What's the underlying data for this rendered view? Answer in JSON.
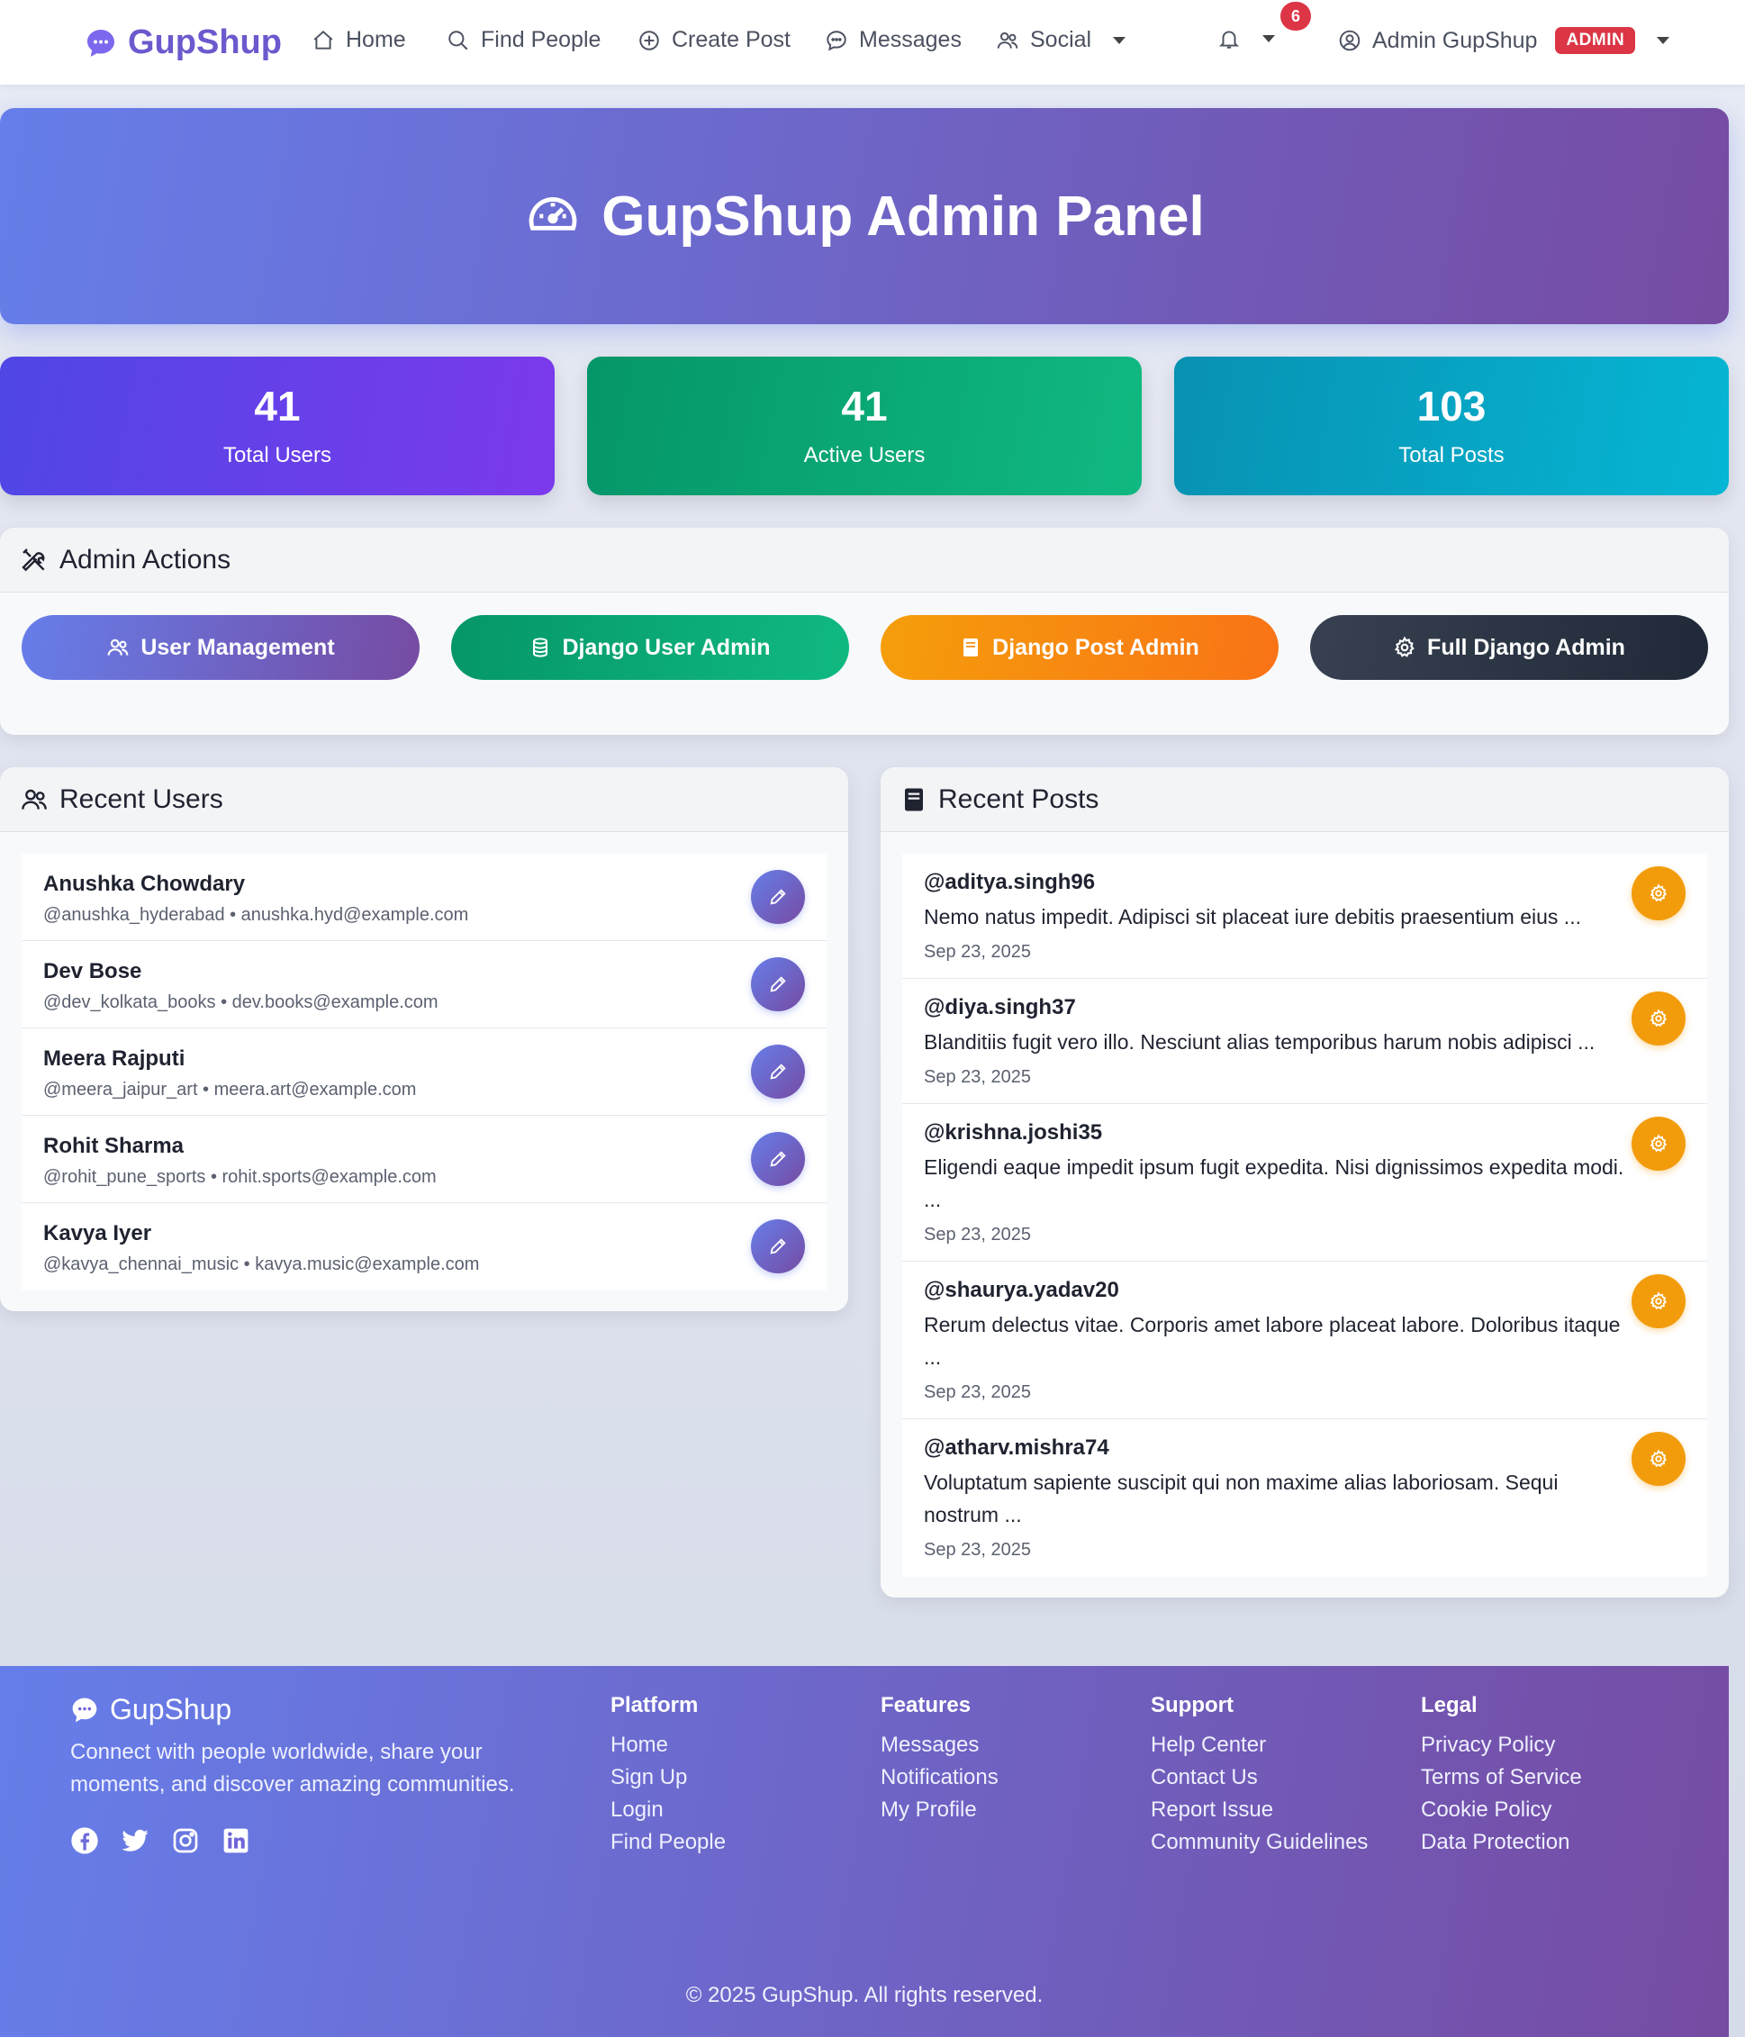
{
  "nav": {
    "brand": "GupShup",
    "items": [
      {
        "label": "Home",
        "icon": "home-icon"
      },
      {
        "label": "Find People",
        "icon": "search-icon"
      },
      {
        "label": "Create Post",
        "icon": "plus-circle-icon"
      },
      {
        "label": "Messages",
        "icon": "chat-icon"
      },
      {
        "label": "Social",
        "icon": "people-icon"
      }
    ],
    "notification_count": "6",
    "user_name": "Admin GupShup",
    "role_badge": "ADMIN"
  },
  "hero": {
    "title": "GupShup Admin Panel",
    "icon": "speedometer-icon"
  },
  "stats": [
    {
      "value": "41",
      "label": "Total Users"
    },
    {
      "value": "41",
      "label": "Active Users"
    },
    {
      "value": "103",
      "label": "Total Posts"
    }
  ],
  "actions": {
    "title": "Admin Actions",
    "buttons": [
      {
        "label": "User Management",
        "icon": "people-icon"
      },
      {
        "label": "Django User Admin",
        "icon": "database-icon"
      },
      {
        "label": "Django Post Admin",
        "icon": "file-icon"
      },
      {
        "label": "Full Django Admin",
        "icon": "gear-icon"
      }
    ]
  },
  "recent_users": {
    "title": "Recent Users",
    "items": [
      {
        "name": "Anushka Chowdary",
        "meta": "@anushka_hyderabad • anushka.hyd@example.com"
      },
      {
        "name": "Dev Bose",
        "meta": "@dev_kolkata_books • dev.books@example.com"
      },
      {
        "name": "Meera Rajputi",
        "meta": "@meera_jaipur_art • meera.art@example.com"
      },
      {
        "name": "Rohit Sharma",
        "meta": "@rohit_pune_sports • rohit.sports@example.com"
      },
      {
        "name": "Kavya Iyer",
        "meta": "@kavya_chennai_music • kavya.music@example.com"
      }
    ]
  },
  "recent_posts": {
    "title": "Recent Posts",
    "items": [
      {
        "user": "@aditya.singh96",
        "text": "Nemo natus impedit. Adipisci sit placeat iure debitis praesentium eius ...",
        "date": "Sep 23, 2025"
      },
      {
        "user": "@diya.singh37",
        "text": "Blanditiis fugit vero illo. Nesciunt alias temporibus harum nobis adipisci ...",
        "date": "Sep 23, 2025"
      },
      {
        "user": "@krishna.joshi35",
        "text": "Eligendi eaque impedit ipsum fugit expedita. Nisi dignissimos expedita modi. ...",
        "date": "Sep 23, 2025"
      },
      {
        "user": "@shaurya.yadav20",
        "text": "Rerum delectus vitae. Corporis amet labore placeat labore. Doloribus itaque ...",
        "date": "Sep 23, 2025"
      },
      {
        "user": "@atharv.mishra74",
        "text": "Voluptatum sapiente suscipit qui non maxime alias laboriosam. Sequi nostrum ...",
        "date": "Sep 23, 2025"
      }
    ]
  },
  "footer": {
    "brand": "GupShup",
    "description": "Connect with people worldwide, share your moments, and discover amazing communities.",
    "social": [
      "facebook-icon",
      "twitter-icon",
      "instagram-icon",
      "linkedin-icon"
    ],
    "columns": [
      {
        "title": "Platform",
        "links": [
          "Home",
          "Sign Up",
          "Login",
          "Find People"
        ]
      },
      {
        "title": "Features",
        "links": [
          "Messages",
          "Notifications",
          "My Profile"
        ]
      },
      {
        "title": "Support",
        "links": [
          "Help Center",
          "Contact Us",
          "Report Issue",
          "Community Guidelines"
        ]
      },
      {
        "title": "Legal",
        "links": [
          "Privacy Policy",
          "Terms of Service",
          "Cookie Policy",
          "Data Protection"
        ]
      }
    ],
    "copyright": "© 2025 GupShup. All rights reserved."
  },
  "colors": {
    "brand_gradient_start": "#667eea",
    "brand_gradient_end": "#764ba2",
    "danger": "#dc3545",
    "success": "#10b981",
    "warning": "#f59e0b",
    "info": "#06b6d4"
  }
}
